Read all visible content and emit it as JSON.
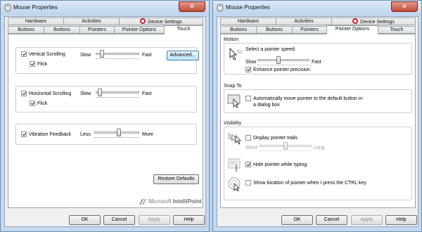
{
  "left": {
    "title": "Mouse Properties",
    "tabs_row1": [
      "Hardware",
      "Activities",
      "Device Settings"
    ],
    "tabs_row2": [
      "Buttons",
      "Buttons",
      "Pointers",
      "Pointer Options",
      "Touch"
    ],
    "selected_tab": "Touch",
    "vertical": {
      "label": "Vertical Scrolling",
      "checked": true,
      "slow": "Slow",
      "fast": "Fast",
      "speed": 0.1,
      "flick_label": "Flick",
      "flick_checked": true,
      "advanced": "Advanced..."
    },
    "horizontal": {
      "label": "Horizontal Scrolling",
      "checked": true,
      "slow": "Slow",
      "fast": "Fast",
      "speed": 0.05,
      "flick_label": "Flick",
      "flick_checked": true
    },
    "vibration": {
      "label": "Vibration Feedback",
      "checked": true,
      "less": "Less",
      "more": "More",
      "level": 0.55
    },
    "restore": "Restore Defaults",
    "brand": {
      "ms": "Microsoft",
      "ip": "IntelliPoint"
    },
    "buttons": {
      "ok": "OK",
      "cancel": "Cancel",
      "apply": "Apply",
      "help": "Help"
    }
  },
  "right": {
    "title": "Mouse Properties",
    "tabs_row1": [
      "Hardware",
      "Activities",
      "Device Settings"
    ],
    "tabs_row2": [
      "Buttons",
      "Buttons",
      "Pointers",
      "Pointer Options",
      "Touch"
    ],
    "selected_tab": "Pointer Options",
    "motion": {
      "title": "Motion",
      "speed_label": "Select a pointer speed:",
      "slow": "Slow",
      "fast": "Fast",
      "speed": 0.4,
      "precision_label": "Enhance pointer precision",
      "precision_checked": true
    },
    "snap": {
      "title": "Snap To",
      "label": "Automatically move pointer to the default button in a dialog box",
      "checked": false
    },
    "visibility": {
      "title": "Visibility",
      "trails_label": "Display pointer trails",
      "trails_checked": false,
      "short": "Short",
      "long": "Long",
      "trails_length": 0.5,
      "hide_label": "Hide pointer while typing",
      "hide_checked": true,
      "ctrl_label": "Show location of pointer when I press the CTRL key",
      "ctrl_checked": false
    },
    "buttons": {
      "ok": "OK",
      "cancel": "Cancel",
      "apply": "Apply",
      "help": "Help"
    }
  },
  "colors": {
    "desktop": "#b9d1ea",
    "close": "#c24a36",
    "device_settings_icon": "#c8232c"
  }
}
